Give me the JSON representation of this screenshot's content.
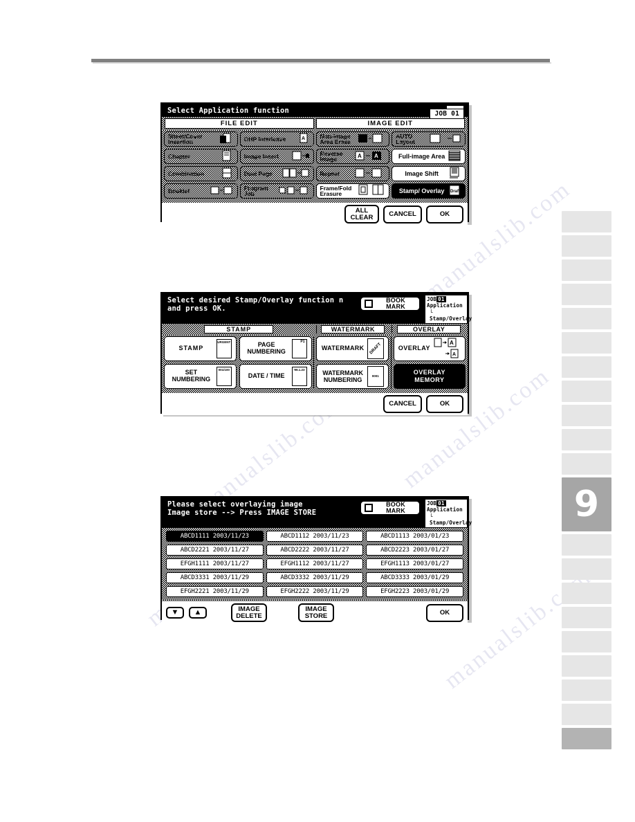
{
  "page": {
    "chapter_number": "9"
  },
  "panel1": {
    "title": "Select Application function",
    "job_badge": "JOB 01",
    "tabs": [
      {
        "label": "FILE EDIT"
      },
      {
        "label": "IMAGE EDIT"
      }
    ],
    "file_edit_col1": [
      {
        "label": "Sheet/Cover Insertion",
        "state": "disabled"
      },
      {
        "label": "Chapter",
        "state": "disabled"
      },
      {
        "label": "Combination",
        "state": "disabled"
      },
      {
        "label": "Booklet",
        "state": "disabled"
      }
    ],
    "file_edit_col2": [
      {
        "label": "OHP Interleave",
        "state": "disabled"
      },
      {
        "label": "Image Insert",
        "state": "disabled"
      },
      {
        "label": "Dual Page",
        "state": "disabled"
      },
      {
        "label": "Program Job",
        "state": "disabled"
      }
    ],
    "image_edit_col1": [
      {
        "label": "Non-image Area Erase",
        "state": "disabled"
      },
      {
        "label": "Reverse Image",
        "state": "disabled"
      },
      {
        "label": "Repeat",
        "state": "disabled"
      },
      {
        "label": "Frame/Fold Erasure",
        "state": "normal"
      }
    ],
    "image_edit_col2": [
      {
        "label": "AUTO Layout",
        "state": "disabled"
      },
      {
        "label": "Full-image Area",
        "state": "normal"
      },
      {
        "label": "Image Shift",
        "state": "normal"
      },
      {
        "label": "Stamp/ Overlay",
        "state": "selected"
      }
    ],
    "footer": [
      {
        "label_line1": "ALL",
        "label_line2": "CLEAR",
        "name": "all-clear-button"
      },
      {
        "label_line1": "CANCEL",
        "label_line2": "",
        "name": "cancel-button"
      },
      {
        "label_line1": "OK",
        "label_line2": "",
        "name": "ok-button"
      }
    ]
  },
  "panel2": {
    "title_line1": "Select desired Stamp/Overlay function n",
    "title_line2": "and press OK.",
    "bookmark_line1": "BOOK",
    "bookmark_line2": "MARK",
    "job_badge_prefix": "JOB",
    "job_badge_number": "01",
    "crumb_line1": "Application",
    "crumb_line2": "└ Stamp/Overlay",
    "tabs": [
      {
        "label": "STAMP"
      },
      {
        "label": "WATERMARK"
      },
      {
        "label": "OVERLAY"
      }
    ],
    "stamp_buttons": [
      {
        "label": "STAMP",
        "card": "URGENT",
        "state": "normal"
      },
      {
        "label": "PAGE NUMBERING",
        "card": "P1",
        "state": "normal"
      },
      {
        "label": "SET NUMBERING",
        "card": "001/100",
        "state": "normal"
      },
      {
        "label": "DATE / TIME",
        "card": "'99.1.23",
        "state": "normal"
      }
    ],
    "watermark_buttons": [
      {
        "label": "WATERMARK",
        "card": "DRAFT",
        "state": "normal"
      },
      {
        "label": "WATERMARK NUMBERING",
        "card": "0001",
        "state": "normal"
      }
    ],
    "overlay_buttons": [
      {
        "label": "OVERLAY",
        "card": "",
        "state": "normal"
      },
      {
        "label": "OVERLAY MEMORY",
        "card": "",
        "state": "selected"
      }
    ],
    "footer": [
      {
        "label_line1": "CANCEL",
        "label_line2": "",
        "name": "cancel-button"
      },
      {
        "label_line1": "OK",
        "label_line2": "",
        "name": "ok-button"
      }
    ]
  },
  "panel3": {
    "title_line1": "Please select overlaying image",
    "title_line2": "Image store --> Press IMAGE STORE",
    "bookmark_line1": "BOOK",
    "bookmark_line2": "MARK",
    "job_badge_prefix": "JOB",
    "job_badge_number": "01",
    "crumb_line1": "Application",
    "crumb_line2": "└ Stamp/Overlay",
    "images": [
      {
        "name": "ABCD1111",
        "date": "2003/11/23",
        "state": "selected"
      },
      {
        "name": "ABCD1112",
        "date": "2003/11/23",
        "state": "normal"
      },
      {
        "name": "ABCD1113",
        "date": "2003/01/23",
        "state": "normal"
      },
      {
        "name": "ABCD2221",
        "date": "2003/11/27",
        "state": "normal"
      },
      {
        "name": "ABCD2222",
        "date": "2003/11/27",
        "state": "normal"
      },
      {
        "name": "ABCD2223",
        "date": "2003/01/27",
        "state": "normal"
      },
      {
        "name": "EFGH1111",
        "date": "2003/11/27",
        "state": "normal"
      },
      {
        "name": "EFGH1112",
        "date": "2003/11/27",
        "state": "normal"
      },
      {
        "name": "EFGH1113",
        "date": "2003/01/27",
        "state": "normal"
      },
      {
        "name": "ABCD3331",
        "date": "2003/11/29",
        "state": "normal"
      },
      {
        "name": "ABCD3332",
        "date": "2003/11/29",
        "state": "normal"
      },
      {
        "name": "ABCD3333",
        "date": "2003/01/29",
        "state": "normal"
      },
      {
        "name": "EFGH2221",
        "date": "2003/11/29",
        "state": "normal"
      },
      {
        "name": "EFGH2222",
        "date": "2003/11/29",
        "state": "normal"
      },
      {
        "name": "EFGH2223",
        "date": "2003/01/29",
        "state": "normal"
      }
    ],
    "scroll_down_icon": "▼",
    "scroll_up_icon": "▲",
    "footer": [
      {
        "label_line1": "IMAGE",
        "label_line2": "DELETE",
        "name": "image-delete-button"
      },
      {
        "label_line1": "IMAGE",
        "label_line2": "STORE",
        "name": "image-store-button"
      },
      {
        "label_line1": "OK",
        "label_line2": "",
        "name": "ok-button"
      }
    ]
  },
  "watermark_text": "manualslib.com"
}
